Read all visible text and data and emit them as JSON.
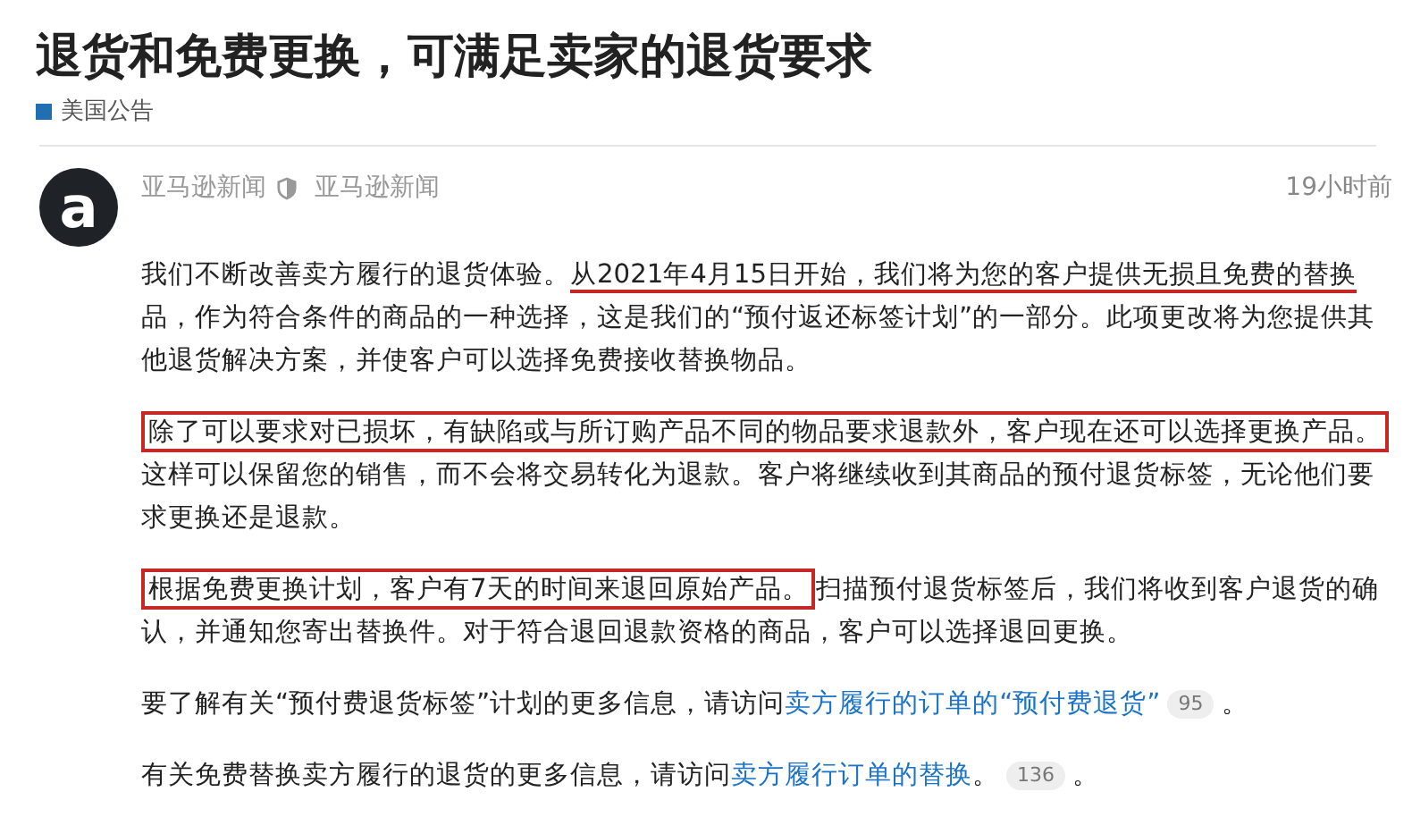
{
  "title": "退货和免费更换，可满足卖家的退货要求",
  "category": {
    "label": "美国公告",
    "color": "#1f6fb2"
  },
  "post": {
    "avatar": "a",
    "author": "亚马逊新闻",
    "author_title": "亚马逊新闻",
    "time": "19小时前",
    "paragraphs": [
      {
        "segments": [
          {
            "kind": "plain",
            "text": "我们不断改善卖方履行的退货体验。"
          },
          {
            "kind": "underline",
            "text": "从2021年4月15日开始，我们将为您的客户提供无损且免费的替换"
          },
          {
            "kind": "plain",
            "text": "品，作为符合条件的商品的一种选择，这是我们的“预付返还标签计划”的一部分。此项更改将为您提供其他退货解决方案，并使客户可以选择免费接收替换物品。"
          }
        ]
      },
      {
        "segments": [
          {
            "kind": "box",
            "text": "除了可以要求对已损坏，有缺陷或与所订购产品不同的物品要求退款外，客户现在还可以选择更换产品。"
          },
          {
            "kind": "plain",
            "text": "这样可以保留您的销售，而不会将交易转化为退款。客户将继续收到其商品的预付退货标签，无论他们要求更换还是退款。"
          }
        ]
      },
      {
        "segments": [
          {
            "kind": "box",
            "text": "根据免费更换计划，客户有7天的时间来退回原始产品。"
          },
          {
            "kind": "plain",
            "text": "扫描预付退货标签后，我们将收到客户退货的确认，并通知您寄出替换件。对于符合退回退款资格的商品，客户可以选择退回更换。"
          }
        ]
      },
      {
        "segments": [
          {
            "kind": "plain",
            "text": "要了解有关“预付费退货标签”计划的更多信息，请访问"
          },
          {
            "kind": "link",
            "text": "卖方履行的订单的“预付费退货”"
          },
          {
            "kind": "count",
            "text": "95"
          },
          {
            "kind": "plain",
            "text": "。"
          }
        ]
      },
      {
        "segments": [
          {
            "kind": "plain",
            "text": "有关免费替换卖方履行的退货的更多信息，请访问"
          },
          {
            "kind": "link",
            "text": "卖方履行订单的替换"
          },
          {
            "kind": "plain",
            "text": "。"
          },
          {
            "kind": "count",
            "text": "136"
          },
          {
            "kind": "plain",
            "text": "。"
          }
        ]
      }
    ]
  }
}
